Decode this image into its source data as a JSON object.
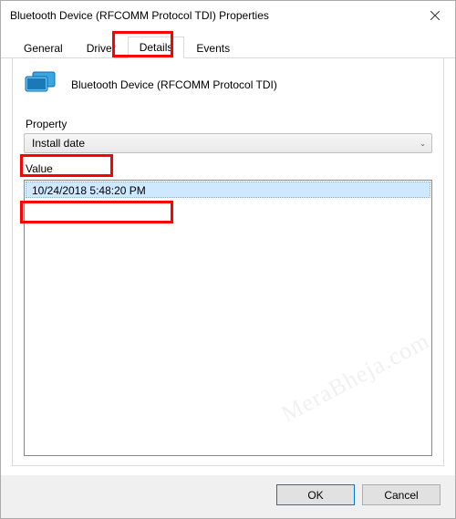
{
  "window": {
    "title": "Bluetooth Device (RFCOMM Protocol TDI) Properties"
  },
  "tabs": [
    {
      "label": "General",
      "active": false
    },
    {
      "label": "Driver",
      "active": false
    },
    {
      "label": "Details",
      "active": true
    },
    {
      "label": "Events",
      "active": false
    }
  ],
  "device": {
    "name": "Bluetooth Device (RFCOMM Protocol TDI)"
  },
  "property": {
    "label": "Property",
    "selected": "Install date"
  },
  "value": {
    "label": "Value",
    "items": [
      "10/24/2018 5:48:20 PM"
    ]
  },
  "buttons": {
    "ok": "OK",
    "cancel": "Cancel"
  },
  "watermark": "MeraBheja.com"
}
